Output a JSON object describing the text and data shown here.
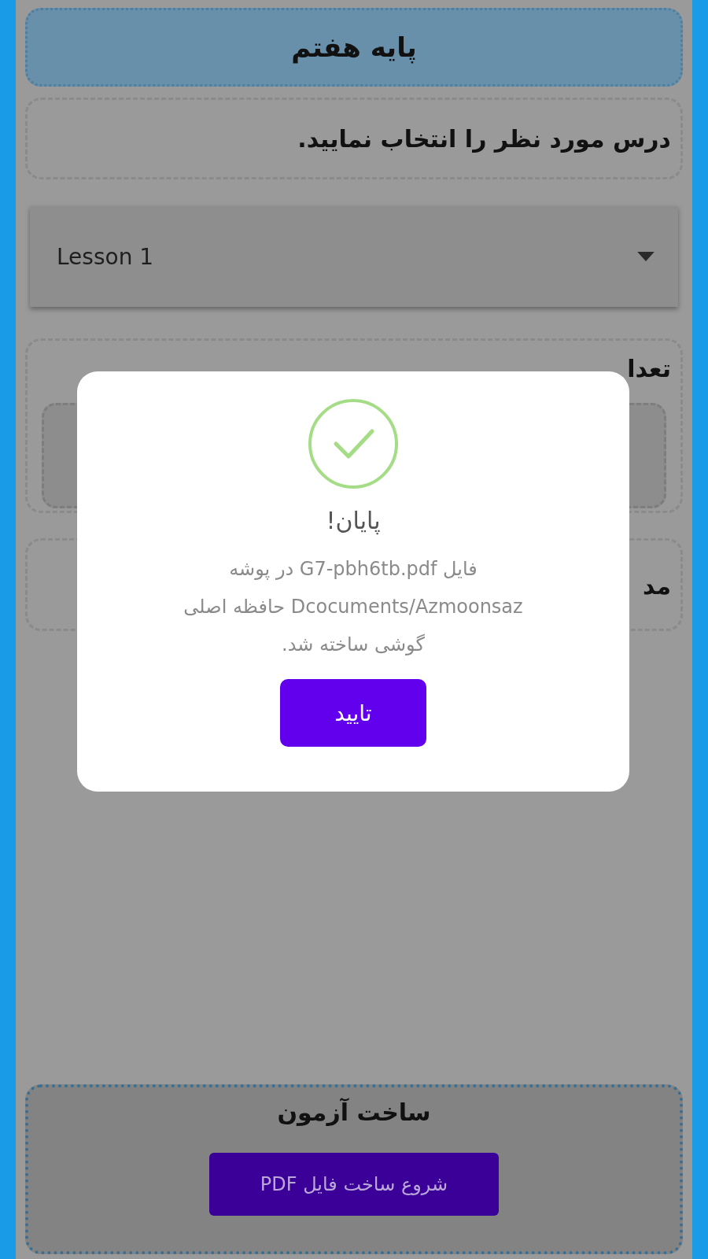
{
  "header": {
    "title": "پایه هفتم"
  },
  "prompt": {
    "text": "درس مورد نظر را انتخاب نمایید."
  },
  "lesson_dropdown": {
    "value": "Lesson 1"
  },
  "count_section": {
    "label": "تعدا"
  },
  "duration_section": {
    "label": "مد"
  },
  "build_section": {
    "title": "ساخت آزمون",
    "button": "شروع ساخت فایل PDF"
  },
  "dialog": {
    "title": "پایان!",
    "message": "فایل G7-pbh6tb.pdf در پوشه Dcocuments/Azmoonsaz حافظه اصلی گوشی ساخته شد.",
    "button": "تایید"
  }
}
